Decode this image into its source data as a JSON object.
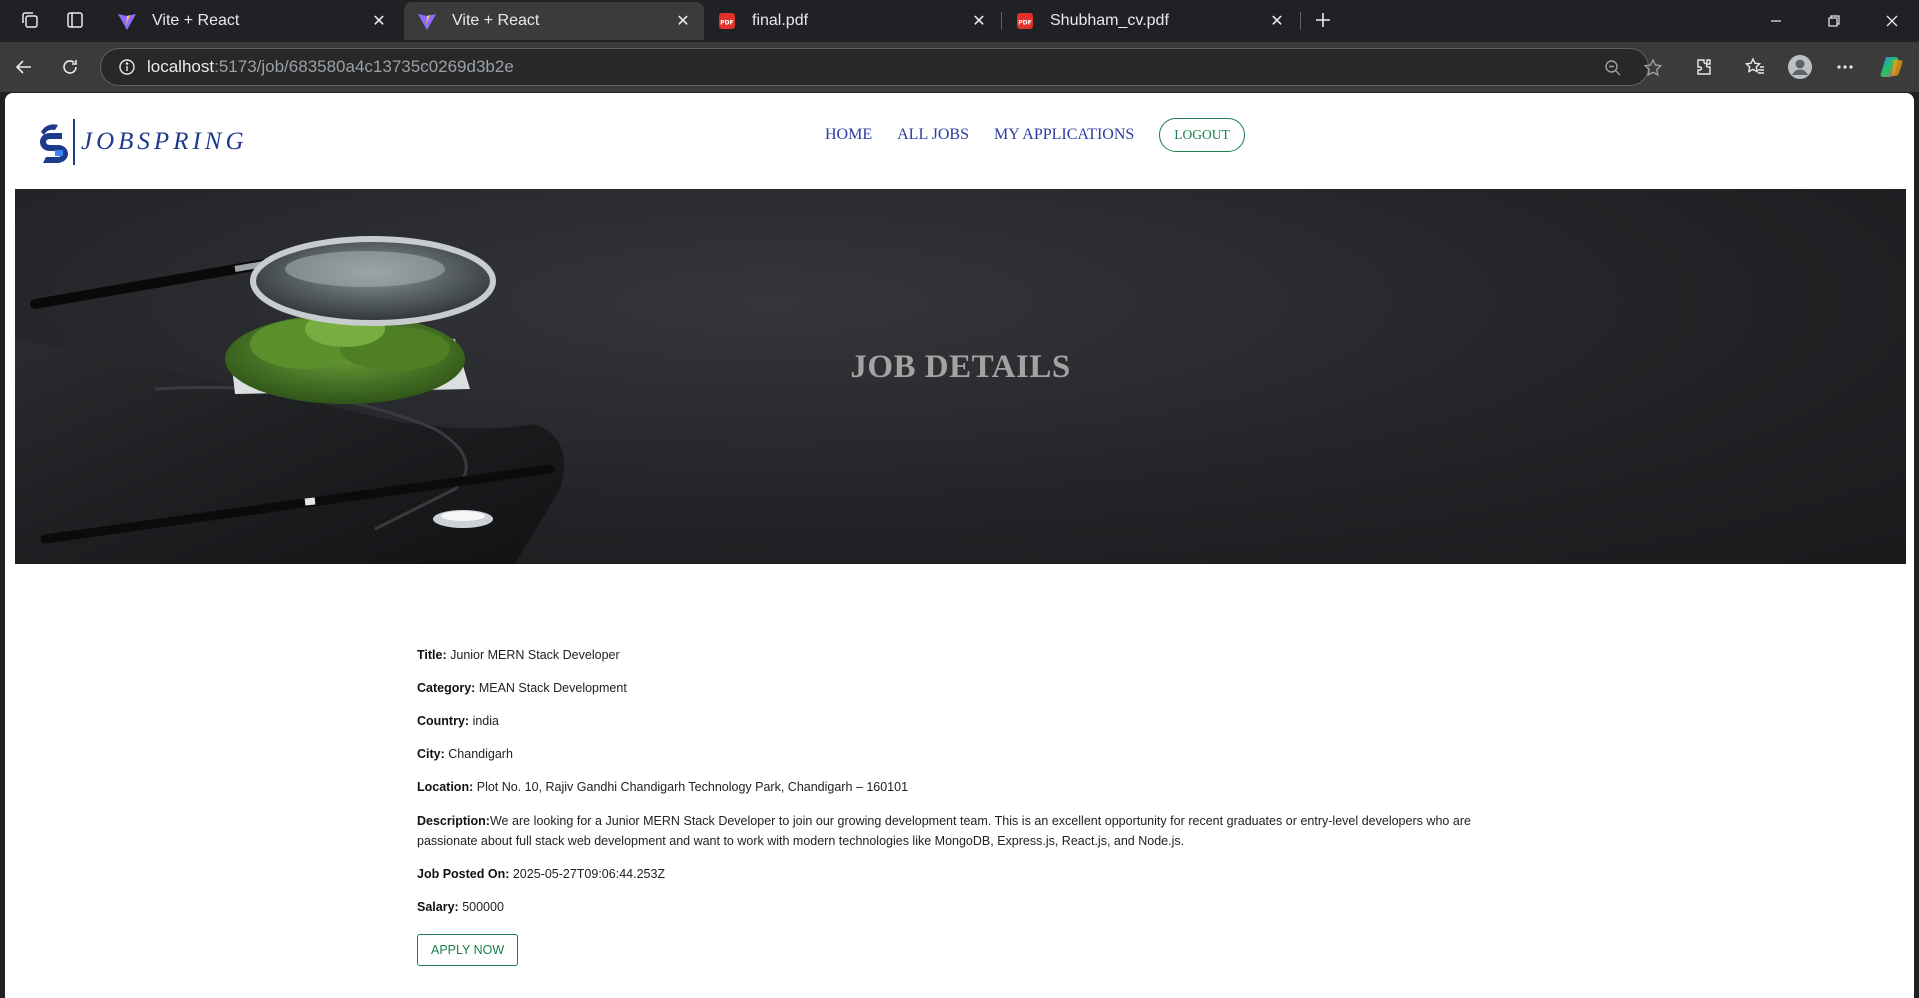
{
  "browser": {
    "tabs": [
      {
        "title": "Vite + React",
        "favicon": "vite-icon",
        "active": false
      },
      {
        "title": "Vite + React",
        "favicon": "vite-icon",
        "active": true
      },
      {
        "title": "final.pdf",
        "favicon": "pdf-icon",
        "active": false
      },
      {
        "title": "Shubham_cv.pdf",
        "favicon": "pdf-icon",
        "active": false
      }
    ],
    "address": {
      "host": "localhost",
      "path": ":5173/job/683580a4c13735c0269d3b2e"
    },
    "colors": {
      "frame": "#202124",
      "toolbar": "#3b3b3b"
    }
  },
  "site": {
    "logo_text": "JOBSPRING",
    "nav": {
      "home": "HOME",
      "all_jobs": "ALL JOBS",
      "my_applications": "MY APPLICATIONS",
      "logout": "LOGOUT"
    },
    "hero_title": "JOB DETAILS",
    "job": {
      "title_label": "Title:",
      "title": "Junior MERN Stack Developer",
      "category_label": "Category:",
      "category": "MEAN Stack Development",
      "country_label": "Country:",
      "country": "india",
      "city_label": "City:",
      "city": "Chandigarh",
      "location_label": "Location:",
      "location": "Plot No. 10, Rajiv Gandhi Chandigarh Technology Park, Chandigarh – 160101",
      "description_label": "Description:",
      "description": "We are looking for a Junior MERN Stack Developer to join our growing development team. This is an excellent opportunity for recent graduates or entry-level developers who are passionate about full stack web development and want to work with modern technologies like MongoDB, Express.js, React.js, and Node.js.",
      "posted_label": "Job Posted On:",
      "posted": "2025-05-27T09:06:44.253Z",
      "salary_label": "Salary:",
      "salary": "500000"
    },
    "apply_label": "APPLY NOW",
    "colors": {
      "brand": "#1e3a8a",
      "nav": "#2b3aa0",
      "accent_green": "#1a7f4b"
    }
  }
}
